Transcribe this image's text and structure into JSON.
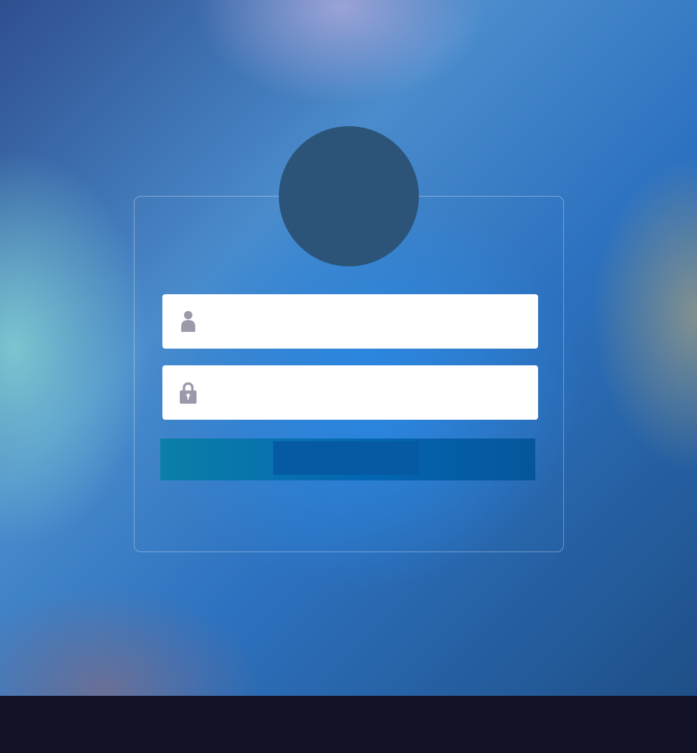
{
  "login": {
    "username_field": {
      "value": "",
      "placeholder": "",
      "icon": "user-icon"
    },
    "password_field": {
      "value": "",
      "placeholder": "",
      "icon": "lock-icon"
    },
    "submit_button": {
      "label": ""
    }
  },
  "colors": {
    "avatar": "#2c5479",
    "button": "#0466b2",
    "icon": "#9a9aaa",
    "taskbar": "#111226"
  }
}
